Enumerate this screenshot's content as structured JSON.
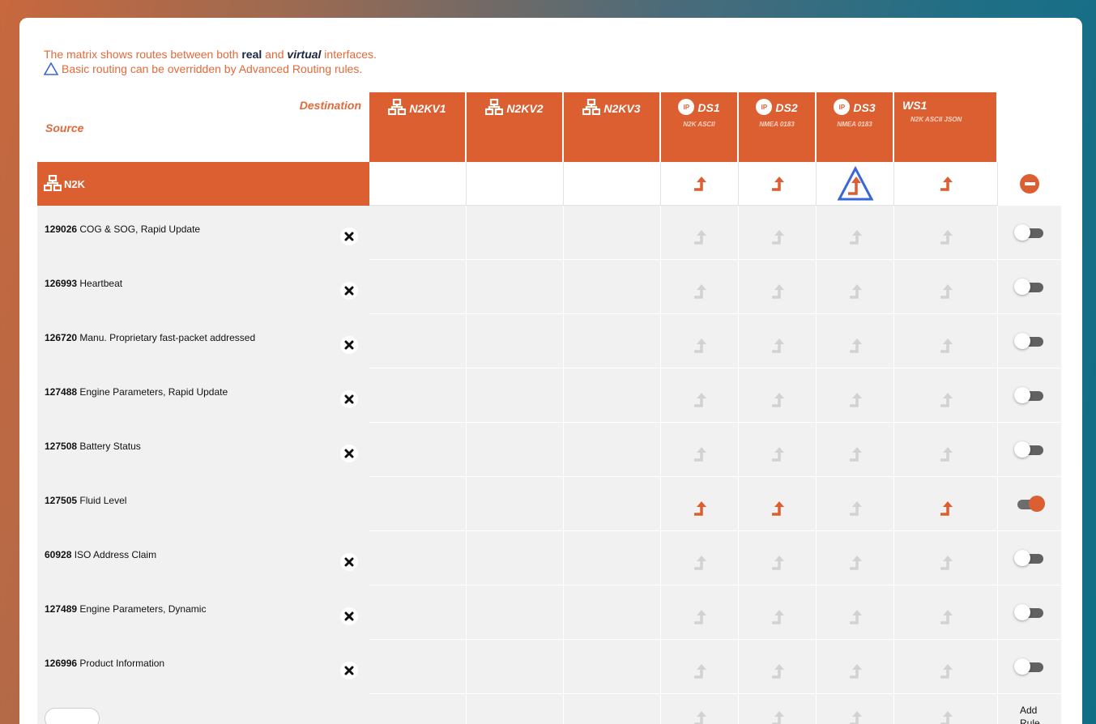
{
  "notes": {
    "line1_pre": "The matrix shows routes between both ",
    "line1_real": "real",
    "line1_mid": " and ",
    "line1_virtual": "virtual",
    "line1_post": " interfaces.",
    "line2": "Basic routing can be overridden by Advanced Routing rules."
  },
  "header": {
    "destination_label": "Destination",
    "source_label": "Source",
    "columns": [
      {
        "title": "N2KV1",
        "subtitle": "",
        "icon": "network-icon"
      },
      {
        "title": "N2KV2",
        "subtitle": "",
        "icon": "network-icon"
      },
      {
        "title": "N2KV3",
        "subtitle": "",
        "icon": "network-icon"
      },
      {
        "title": "DS1",
        "subtitle": "N2K ASCII",
        "icon": "ip-pin-icon",
        "icon_text": "IP"
      },
      {
        "title": "DS2",
        "subtitle": "NMEA 0183",
        "icon": "ip-pin-icon",
        "icon_text": "IP"
      },
      {
        "title": "DS3",
        "subtitle": "NMEA 0183",
        "icon": "ip-pin-icon",
        "icon_text": "IP"
      },
      {
        "title": "WS1",
        "subtitle": "N2K ASCII JSON",
        "icon": ""
      }
    ]
  },
  "source": {
    "name": "N2K",
    "routes": [
      false,
      false,
      false,
      true,
      true,
      true,
      true
    ],
    "override_on": "DS3"
  },
  "rules": [
    {
      "pgn": "129026",
      "name": " COG & SOG, Rapid Update",
      "removable": true,
      "enabled": false
    },
    {
      "pgn": "126993",
      "name": " Heartbeat",
      "removable": true,
      "enabled": false
    },
    {
      "pgn": "126720",
      "name": " Manu. Proprietary fast-packet addressed",
      "removable": true,
      "enabled": false
    },
    {
      "pgn": "127488",
      "name": " Engine Parameters, Rapid Update",
      "removable": true,
      "enabled": false
    },
    {
      "pgn": "127508",
      "name": " Battery Status",
      "removable": true,
      "enabled": false
    },
    {
      "pgn": "127505",
      "name": " Fluid Level",
      "removable": false,
      "enabled": true
    },
    {
      "pgn": "60928",
      "name": " ISO Address Claim",
      "removable": true,
      "enabled": false
    },
    {
      "pgn": "127489",
      "name": " Engine Parameters, Dynamic",
      "removable": true,
      "enabled": false
    },
    {
      "pgn": "126996",
      "name": " Product Information",
      "removable": true,
      "enabled": false
    }
  ],
  "add_rule": {
    "label": "Add Rule",
    "input_value": ""
  },
  "colors": {
    "accent": "#dc5f32",
    "inactive_arrow": "#d2d2d2",
    "override_triangle": "#3a66d8"
  }
}
